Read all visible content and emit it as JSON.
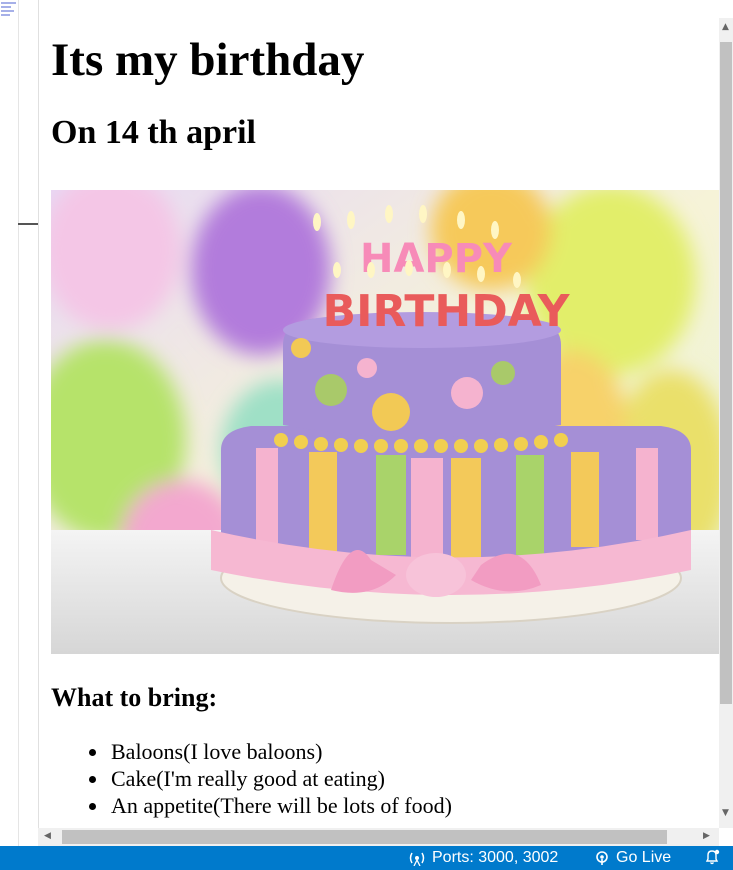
{
  "preview": {
    "heading": "Its my birthday",
    "subheading": "On 14 th april",
    "image_text": [
      "HAPPY",
      "BIRTHDAY"
    ],
    "bring_heading": "What to bring:",
    "bring_items": [
      "Baloons(I love baloons)",
      "Cake(I'm really good at eating)",
      "An appetite(There will be lots of food)"
    ]
  },
  "statusbar": {
    "ports": "Ports: 3000, 3002",
    "golive": "Go Live"
  },
  "colors": {
    "statusbar": "#007acc",
    "cake_purple": "#a58fd6",
    "pink": "#f5b3cf"
  }
}
